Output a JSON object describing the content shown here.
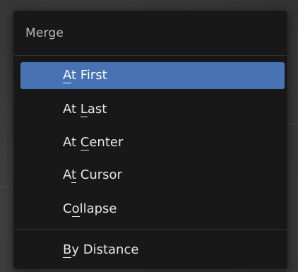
{
  "menu": {
    "title": "Merge",
    "items": [
      {
        "label": "At First",
        "underline_index": 0,
        "active": true
      },
      {
        "label": "At Last",
        "underline_index": 3,
        "active": false
      },
      {
        "label": "At Center",
        "underline_index": 3,
        "active": false
      },
      {
        "label": "At Cursor",
        "underline_index": 1,
        "active": false
      },
      {
        "label": "Collapse",
        "underline_index": 1,
        "active": false
      },
      {
        "label": "By Distance",
        "underline_index": 0,
        "active": false
      }
    ]
  },
  "colors": {
    "menu_background": "#181818",
    "highlight": "#4772b3",
    "text": "#e6e6e6",
    "title_text": "#b8b8b8"
  }
}
